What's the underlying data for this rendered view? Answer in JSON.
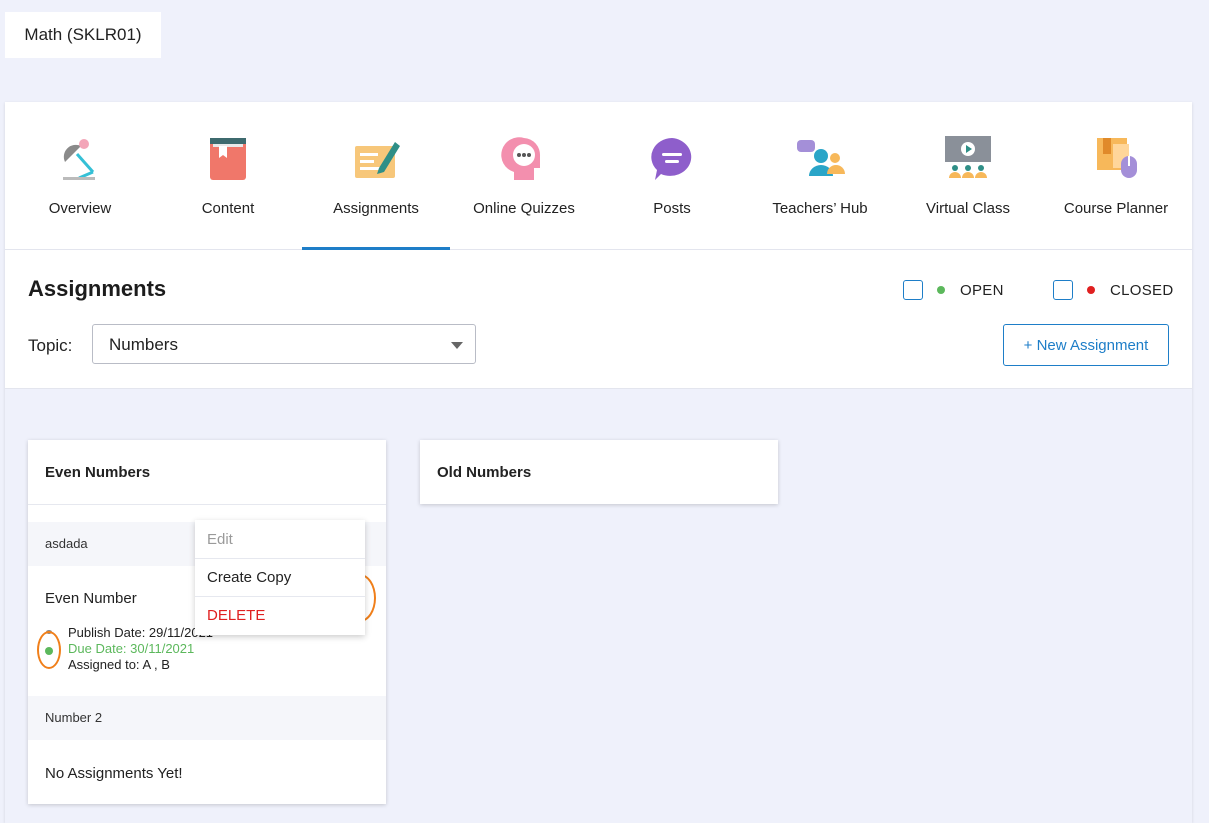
{
  "course": {
    "name": "Math (SKLR01)"
  },
  "tabs": [
    {
      "label": "Overview",
      "icon": "lamp-icon"
    },
    {
      "label": "Content",
      "icon": "book-icon"
    },
    {
      "label": "Assignments",
      "icon": "assignment-pen-icon",
      "active": true
    },
    {
      "label": "Online Quizzes",
      "icon": "thinking-head-icon"
    },
    {
      "label": "Posts",
      "icon": "chat-bubble-icon"
    },
    {
      "label": "Teachers’ Hub",
      "icon": "people-chat-icon"
    },
    {
      "label": "Virtual Class",
      "icon": "presentation-screen-icon"
    },
    {
      "label": "Course Planner",
      "icon": "planner-icon"
    }
  ],
  "header": {
    "title": "Assignments",
    "legend": [
      {
        "label": "OPEN",
        "color": "#5cb85c"
      },
      {
        "label": "CLOSED",
        "color": "#e02020"
      }
    ],
    "topic_label": "Topic:",
    "topic_value": "Numbers",
    "new_button": "+ New Assignment"
  },
  "columns": [
    {
      "title": "Even Numbers",
      "groups": [
        {
          "name": "asdada",
          "items": [
            {
              "title": "Even Number",
              "publish": "Publish Date: 29/11/2021",
              "due": "Due Date: 30/11/2021",
              "assigned": "Assigned to: A , B",
              "status": "open"
            }
          ]
        },
        {
          "name": "Number 2",
          "empty_text": "No Assignments Yet!"
        }
      ]
    },
    {
      "title": "Old Numbers"
    }
  ],
  "context_menu": {
    "items": [
      {
        "label": "Edit",
        "color": "#9a9a9a"
      },
      {
        "label": "Create Copy",
        "color": "#222222"
      },
      {
        "label": "DELETE",
        "color": "#e02020"
      }
    ]
  },
  "colors": {
    "accent": "#1e7ec8",
    "highlight": "#f07f1a"
  }
}
